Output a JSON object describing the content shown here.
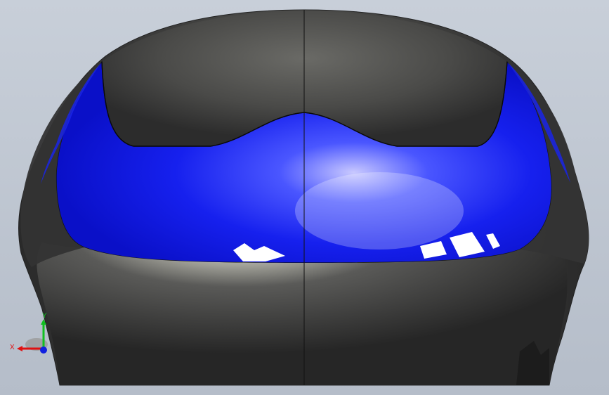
{
  "viewport": {
    "background_top": "#c5ccd6",
    "background_bottom": "#b7bfcb",
    "model_color": "#3c3c3c",
    "visor_color": "#0a14e6"
  },
  "triad": {
    "x_label": "X",
    "y_label": "Y",
    "x_color": "#e01010",
    "y_color": "#10c020",
    "z_color": "#1020e0"
  }
}
